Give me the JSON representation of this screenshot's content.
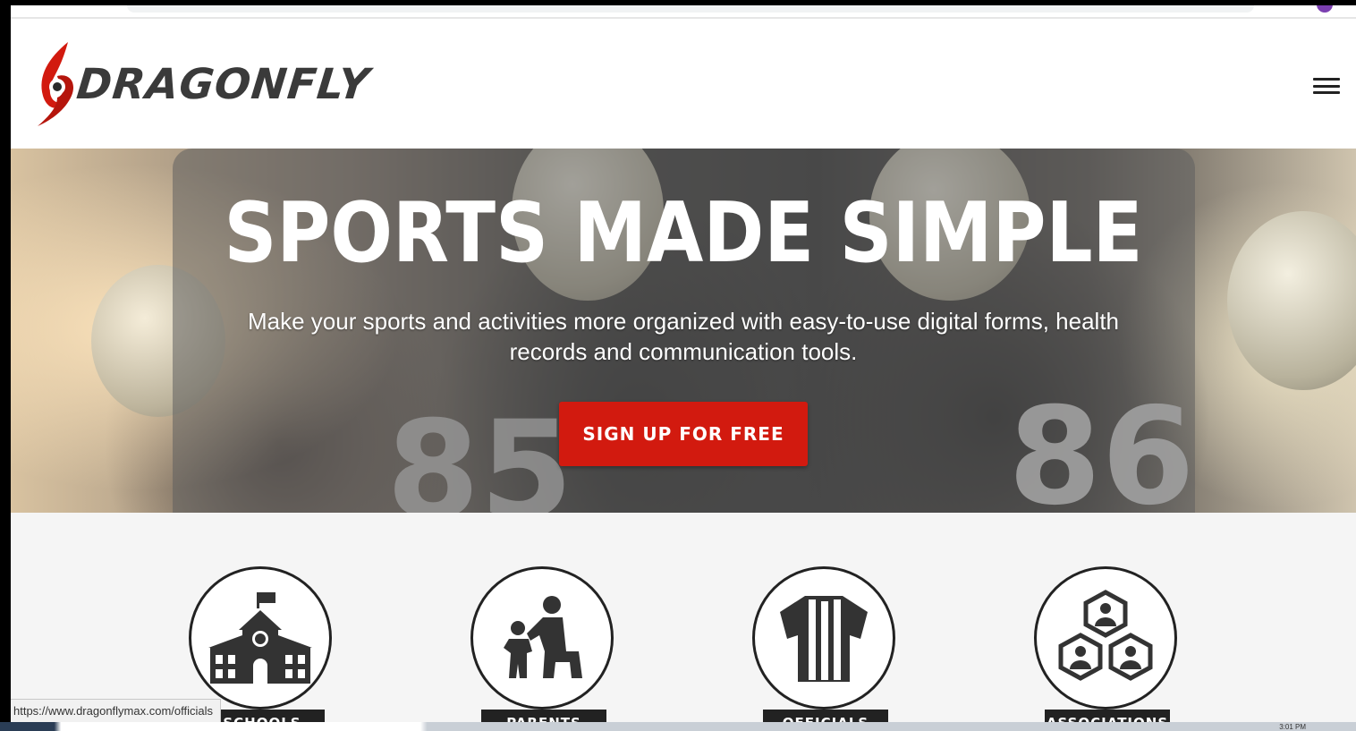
{
  "brand": {
    "name": "DragonFly",
    "logo_text": "DRAGONFLY",
    "accent_color": "#d21a0f",
    "text_color": "#3a3a3a"
  },
  "header": {
    "menu_icon": "hamburger-menu-icon"
  },
  "hero": {
    "title": "SPORTS MADE SIMPLE",
    "subtitle": "Make your sports and activities more organized with easy-to-use digital forms, health records and communication tools.",
    "cta_label": "SIGN UP FOR FREE",
    "jersey_numbers": [
      "85",
      "86"
    ]
  },
  "roles": [
    {
      "label": "SCHOOLS",
      "icon": "school-building-icon"
    },
    {
      "label": "PARENTS",
      "icon": "parent-child-icon"
    },
    {
      "label": "OFFICIALS",
      "icon": "referee-jersey-icon"
    },
    {
      "label": "ASSOCIATIONS",
      "icon": "association-group-icon"
    }
  ],
  "status_bar": {
    "url": "https://www.dragonflymax.com/officials"
  },
  "taskbar": {
    "clock": "3:01 PM"
  }
}
